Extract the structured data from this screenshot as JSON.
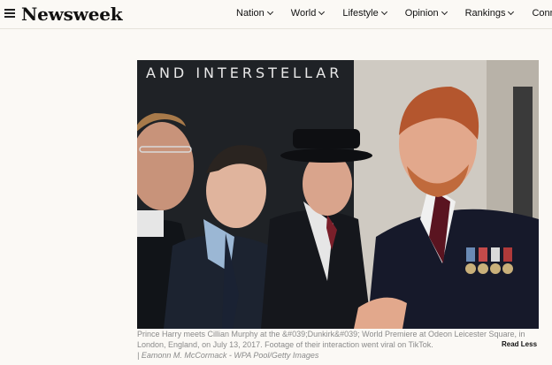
{
  "header": {
    "logo": "Newsweek",
    "nav": [
      {
        "label": "Nation"
      },
      {
        "label": "World"
      },
      {
        "label": "Lifestyle"
      },
      {
        "label": "Opinion"
      },
      {
        "label": "Rankings"
      },
      {
        "label": "Conn"
      }
    ]
  },
  "photo": {
    "backdrop_text": "AND INTERSTELLAR"
  },
  "caption": {
    "text": "Prince Harry meets Cillian Murphy at the &#039;Dunkirk&#039; World Premiere at Odeon Leicester Square, in London, England, on July 13, 2017. Footage of their interaction went viral on TikTok.",
    "read_less": "Read Less",
    "credit": "| Eamonn M. McCormack - WPA Pool/Getty Images"
  },
  "colors": {
    "background": "#fbf9f5",
    "caption_text": "#8a8a8a"
  }
}
